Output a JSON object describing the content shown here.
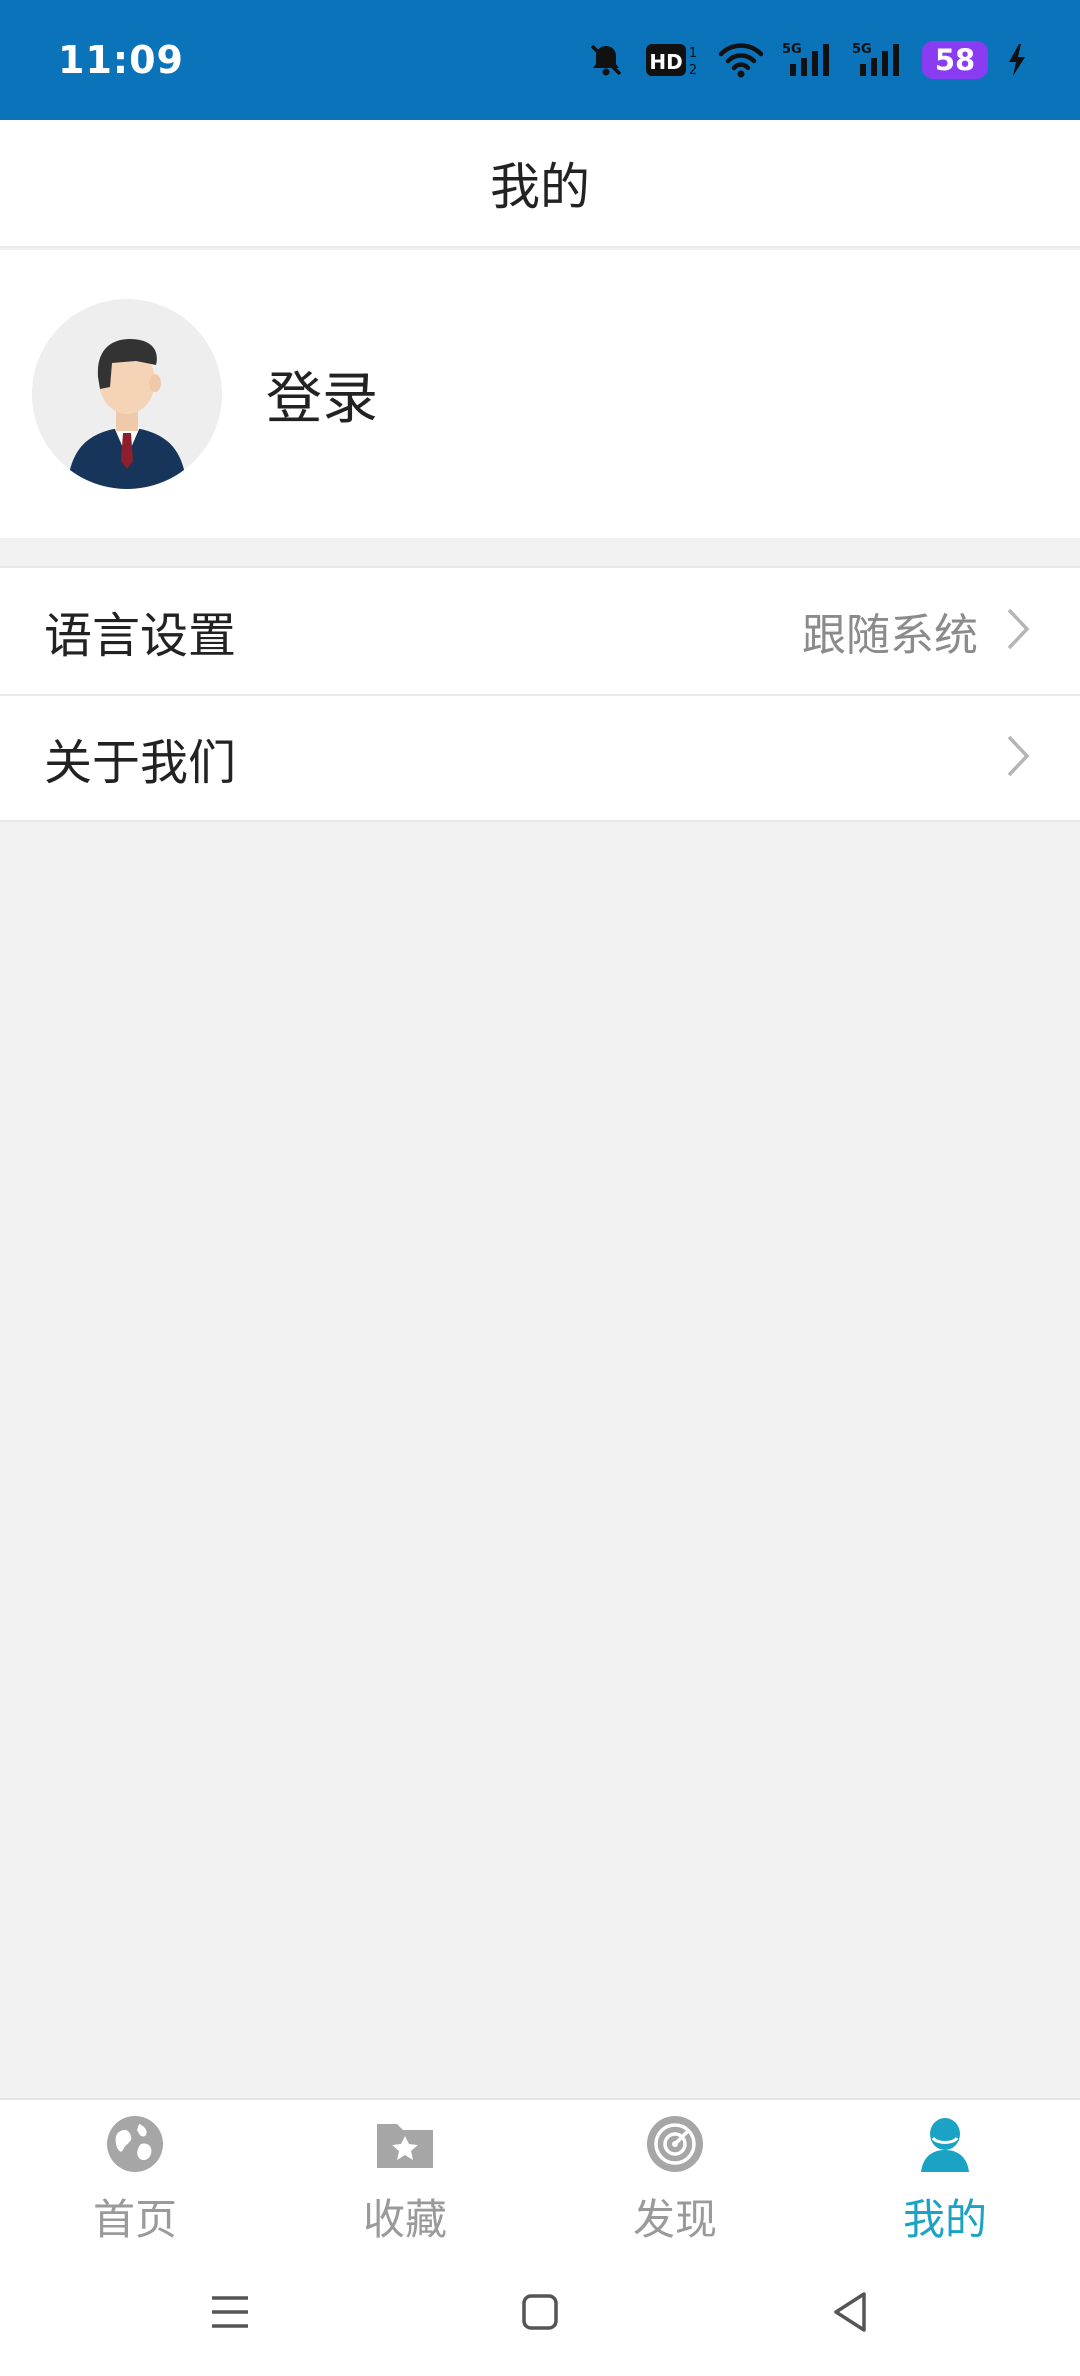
{
  "status_bar": {
    "time": "11:09",
    "battery": "58",
    "icons": [
      "bell-off-icon",
      "hd-icon",
      "wifi-icon",
      "signal-5g-icon",
      "signal-5g-icon",
      "battery-icon",
      "charging-icon"
    ]
  },
  "header": {
    "title": "我的"
  },
  "profile": {
    "login_label": "登录",
    "avatar_icon": "user-avatar-icon"
  },
  "menu": {
    "items": [
      {
        "label": "语言设置",
        "value": "跟随系统",
        "icon": "chevron-right-icon"
      },
      {
        "label": "关于我们",
        "value": "",
        "icon": "chevron-right-icon"
      }
    ]
  },
  "tabs": [
    {
      "label": "首页",
      "icon": "globe-icon",
      "active": false
    },
    {
      "label": "收藏",
      "icon": "folder-star-icon",
      "active": false
    },
    {
      "label": "发现",
      "icon": "radar-icon",
      "active": false
    },
    {
      "label": "我的",
      "icon": "user-icon",
      "active": true
    }
  ],
  "colors": {
    "status_bar_bg": "#0a73b9",
    "accent": "#1aa3c4",
    "inactive": "#9a9a9a",
    "battery": "#8a3cf2",
    "background": "#f2f2f2"
  },
  "system_nav": [
    "menu-icon",
    "home-icon",
    "back-icon"
  ]
}
